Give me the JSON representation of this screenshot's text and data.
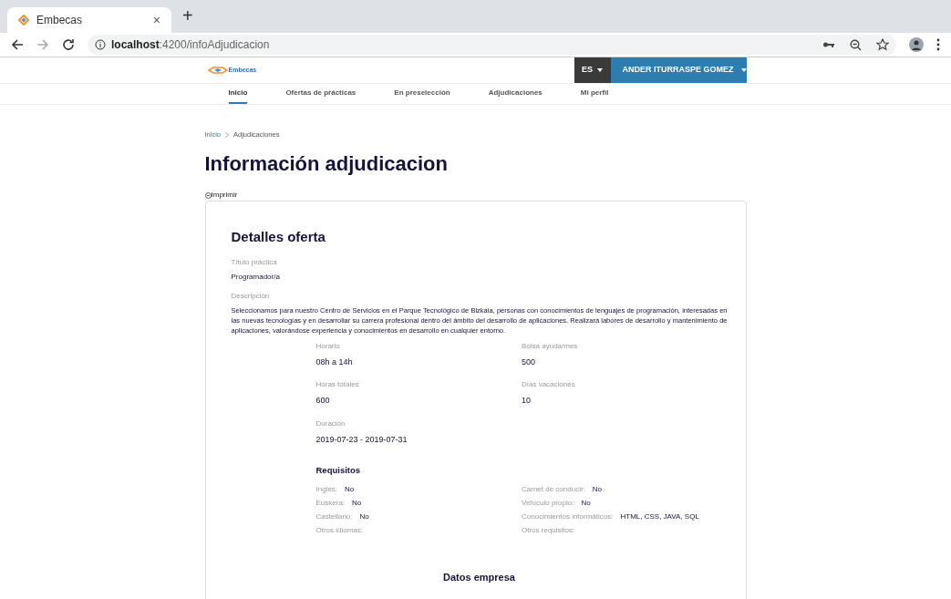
{
  "browser": {
    "tab_title": "Embecas",
    "tab_close": "×",
    "new_tab": "+",
    "url_host": "localhost",
    "url_path": ":4200/infoAdjudicacion"
  },
  "header": {
    "logo_text": "Embecas",
    "language": "ES",
    "user": "ANDER ITURRASPE GOMEZ"
  },
  "nav": [
    {
      "label": "Inicio",
      "selected": true
    },
    {
      "label": "Ofertas de prácticas",
      "selected": false
    },
    {
      "label": "En preselección",
      "selected": false
    },
    {
      "label": "Adjudicaciones",
      "selected": false
    },
    {
      "label": "Mi perfil",
      "selected": false
    }
  ],
  "breadcrumb": [
    "Inicio",
    "Adjudicaciones"
  ],
  "page_title": "Información adjudicacion",
  "print_link": "Imprimir",
  "card": {
    "title": "Detalles oferta",
    "titulo_label": "Título práctica",
    "titulo_value": "Programador/a",
    "descripcion_label": "Descripción",
    "descripcion_value": "Seleccionamos para nuestro Centro de Servicios en el Parque Tecnológico de Bizkaia, personas con conocimientos de lenguajes de programación, interesadas en las nuevas tecnologías y en desarrollar su carrera profesional dentro del ámbito del desarrollo de aplicaciones. Realizará labores de desarrollo y mantenimiento de aplicaciones, valorándose experiencia y conocimientos en desarrollo en cualquier entorno.",
    "fields": [
      {
        "label": "Horario",
        "value": "08h a 14h"
      },
      {
        "label": "Bolsa ayuda/mes",
        "value": "500"
      },
      {
        "label": "Horas totales",
        "value": "600"
      },
      {
        "label": "Días vacaciones",
        "value": "10"
      },
      {
        "label": "Duración",
        "value": "2019-07-23 - 2019-07-31"
      }
    ],
    "requisitos_title": "Requisitos",
    "requisitos_left": [
      {
        "label": "Inglés:",
        "value": "No"
      },
      {
        "label": "Euskera:",
        "value": "No"
      },
      {
        "label": "Castellano:",
        "value": "No"
      },
      {
        "label": "Otros idiomas:"
      }
    ],
    "requisitos_right": [
      {
        "label": "Carnet de conducir:",
        "value": "No"
      },
      {
        "label": "Vehículo propio:",
        "value": "No"
      },
      {
        "label": "Conocimientos informáticos:",
        "value": "HTML, CSS, JAVA, SQL"
      },
      {
        "label": "Otros requisitos:"
      }
    ],
    "empresa_title": "Datos empresa"
  }
}
